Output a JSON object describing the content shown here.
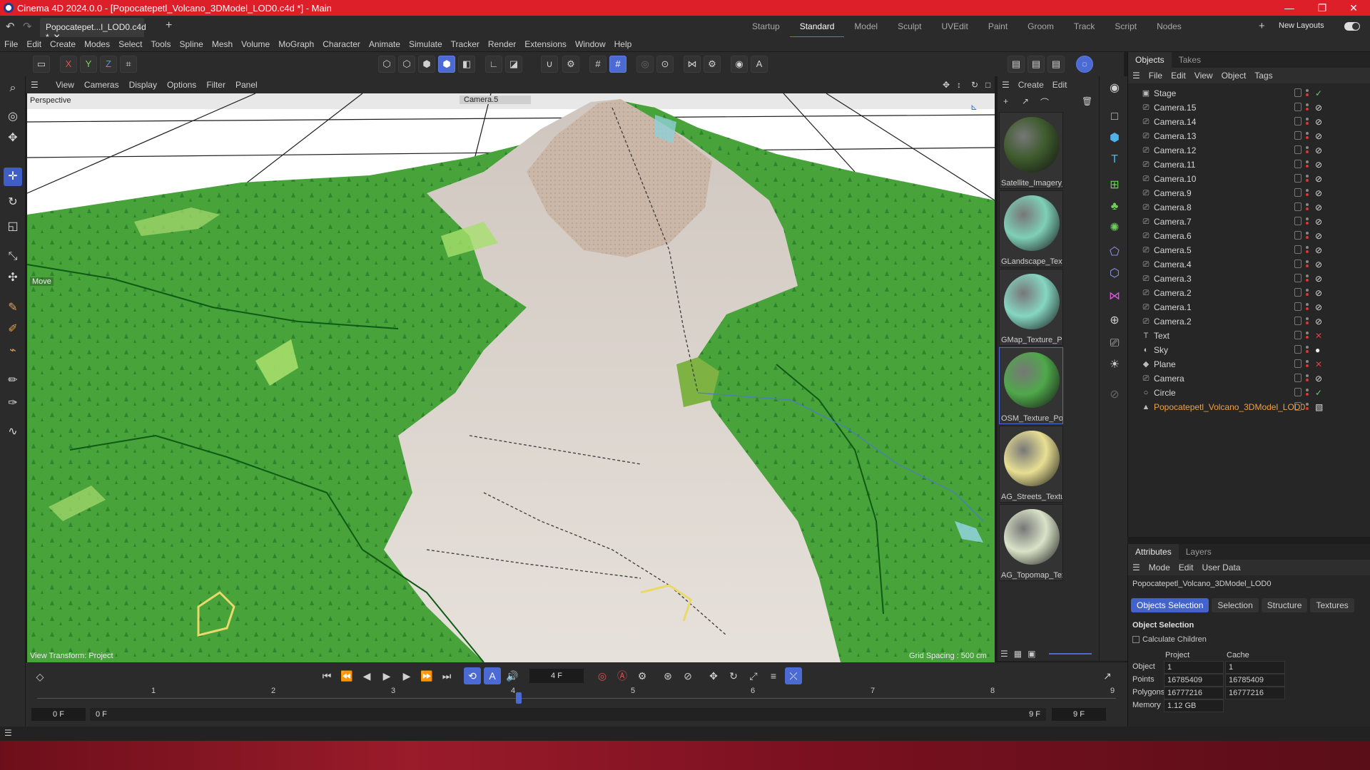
{
  "title_bar": {
    "text": "Cinema 4D 2024.0.0 - [Popocatepetl_Volcano_3DModel_LOD0.c4d *] - Main",
    "controls": [
      "—",
      "❐",
      "✕"
    ]
  },
  "tabs": {
    "file_tab": "Popocatepet...l_LOD0.c4d *",
    "add": "+"
  },
  "layouts": {
    "items": [
      "Startup",
      "Standard",
      "Model",
      "Sculpt",
      "UVEdit",
      "Paint",
      "Groom",
      "Track",
      "Script",
      "Nodes"
    ],
    "active": "Standard",
    "new_layouts": "New Layouts"
  },
  "menu": [
    "File",
    "Edit",
    "Create",
    "Modes",
    "Select",
    "Tools",
    "Spline",
    "Mesh",
    "Volume",
    "MoGraph",
    "Character",
    "Animate",
    "Simulate",
    "Tracker",
    "Render",
    "Extensions",
    "Window",
    "Help"
  ],
  "toolbar": {
    "axes": [
      "X",
      "Y",
      "Z"
    ]
  },
  "viewport": {
    "menu": [
      "View",
      "Cameras",
      "Display",
      "Options",
      "Filter",
      "Panel"
    ],
    "label": "Perspective",
    "camera": "Camera.5",
    "tool_label": "Move",
    "transform": "View Transform: Project",
    "grid": "Grid Spacing : 500 cm"
  },
  "materials": {
    "menu": [
      "Create",
      "Edit"
    ],
    "items": [
      {
        "name": "Satellite_Imagery_",
        "color": "#3d5a2c"
      },
      {
        "name": "GLandscape_Textu",
        "color": "#7fcfb6"
      },
      {
        "name": "GMap_Texture_Po",
        "color": "#86d6c2"
      },
      {
        "name": "OSM_Texture_Pop",
        "color": "#4fa84a"
      },
      {
        "name": "AG_Streets_Textur",
        "color": "#e8df93"
      },
      {
        "name": "AG_Topomap_Tex",
        "color": "#d9e3c8"
      }
    ]
  },
  "objects": {
    "tabs": [
      "Objects",
      "Takes"
    ],
    "menu": [
      "File",
      "Edit",
      "View",
      "Object",
      "Tags"
    ],
    "items": [
      {
        "name": "Stage",
        "icon": "stage-icon",
        "tag": "check"
      },
      {
        "name": "Camera.15",
        "icon": "camera-icon",
        "tag": "camera"
      },
      {
        "name": "Camera.14",
        "icon": "camera-icon",
        "tag": "camera"
      },
      {
        "name": "Camera.13",
        "icon": "camera-icon",
        "tag": "camera"
      },
      {
        "name": "Camera.12",
        "icon": "camera-icon",
        "tag": "camera"
      },
      {
        "name": "Camera.11",
        "icon": "camera-icon",
        "tag": "camera"
      },
      {
        "name": "Camera.10",
        "icon": "camera-icon",
        "tag": "camera"
      },
      {
        "name": "Camera.9",
        "icon": "camera-icon",
        "tag": "camera"
      },
      {
        "name": "Camera.8",
        "icon": "camera-icon",
        "tag": "camera"
      },
      {
        "name": "Camera.7",
        "icon": "camera-icon",
        "tag": "camera"
      },
      {
        "name": "Camera.6",
        "icon": "camera-icon",
        "tag": "camera"
      },
      {
        "name": "Camera.5",
        "icon": "camera-icon",
        "tag": "camera"
      },
      {
        "name": "Camera.4",
        "icon": "camera-icon",
        "tag": "camera"
      },
      {
        "name": "Camera.3",
        "icon": "camera-icon",
        "tag": "camera"
      },
      {
        "name": "Camera.2",
        "icon": "camera-icon",
        "tag": "camera"
      },
      {
        "name": "Camera.1",
        "icon": "camera-icon",
        "tag": "camera"
      },
      {
        "name": "Camera.2",
        "icon": "camera-icon",
        "tag": "camera"
      },
      {
        "name": "Text",
        "icon": "text-icon",
        "tag": "cross"
      },
      {
        "name": "Sky",
        "icon": "sky-icon",
        "tag": "sphere"
      },
      {
        "name": "Plane",
        "icon": "plane-icon",
        "tag": "cross"
      },
      {
        "name": "Camera",
        "icon": "camera-icon",
        "tag": "camera"
      },
      {
        "name": "Circle",
        "icon": "circle-icon",
        "tag": "check"
      },
      {
        "name": "Popocatepetl_Volcano_3DModel_LOD0",
        "icon": "polygon-icon",
        "tag": "texture",
        "highlight": true
      }
    ]
  },
  "attributes": {
    "tabs": [
      "Attributes",
      "Layers"
    ],
    "menu": [
      "Mode",
      "Edit",
      "User Data"
    ],
    "object_name": "Popocatepetl_Volcano_3DModel_LOD0",
    "subtabs": [
      "Objects Selection",
      "Selection",
      "Structure",
      "Textures"
    ],
    "section": "Object Selection",
    "checkbox": "Calculate Children",
    "columns": [
      "Project",
      "Cache"
    ],
    "rows": [
      {
        "label": "Object",
        "project": "1",
        "cache": "1"
      },
      {
        "label": "Points",
        "project": "16785409",
        "cache": "16785409"
      },
      {
        "label": "Polygons",
        "project": "16777216",
        "cache": "16777216"
      },
      {
        "label": "Memory",
        "project": "1.12 GB",
        "cache": ""
      }
    ]
  },
  "timeline": {
    "frame_display": "4 F",
    "ticks": [
      "1",
      "2",
      "3",
      "4",
      "5",
      "6",
      "7",
      "8",
      "9"
    ],
    "start": "0 F",
    "start2": "0 F",
    "end": "9 F",
    "end2": "9 F",
    "current_fraction": 0.444
  }
}
